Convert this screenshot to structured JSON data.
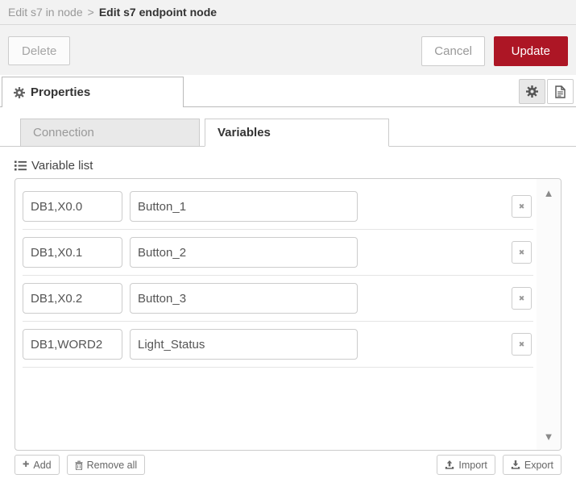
{
  "header": {
    "breadcrumb_parent": "Edit s7 in node",
    "breadcrumb_separator": ">",
    "breadcrumb_current": "Edit s7 endpoint node"
  },
  "toolbar": {
    "delete_label": "Delete",
    "cancel_label": "Cancel",
    "update_label": "Update"
  },
  "tabs": {
    "properties_label": "Properties"
  },
  "subtabs": {
    "connection_label": "Connection",
    "variables_label": "Variables",
    "active": "Variables"
  },
  "variable_list": {
    "label": "Variable list",
    "rows": [
      {
        "address": "DB1,X0.0",
        "name": "Button_1"
      },
      {
        "address": "DB1,X0.1",
        "name": "Button_2"
      },
      {
        "address": "DB1,X0.2",
        "name": "Button_3"
      },
      {
        "address": "DB1,WORD2",
        "name": "Light_Status"
      }
    ]
  },
  "footer": {
    "add_label": "Add",
    "remove_all_label": "Remove all",
    "import_label": "Import",
    "export_label": "Export"
  },
  "icons": {
    "gear": "svg-gear-shape",
    "doc": "svg-document-shape",
    "list": "svg-list-shape",
    "trash": "svg-trash-shape",
    "import": "svg-upload-shape",
    "export": "svg-download-shape",
    "add_plus": "✚",
    "remove_x": "✖",
    "scroll_up": "▲",
    "scroll_down": "▼"
  },
  "colors": {
    "accent_red": "#ad1625",
    "toolbar_bg": "#f2f2f2",
    "border": "#cccccc",
    "inactive_tab_bg": "#e9e9e9"
  }
}
